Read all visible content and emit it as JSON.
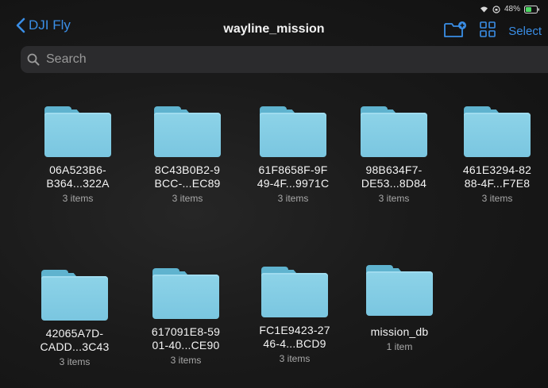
{
  "status_bar": {
    "battery": "48%"
  },
  "nav": {
    "back_label": "DJI Fly",
    "title": "wayline_mission",
    "select_label": "Select"
  },
  "search": {
    "placeholder": "Search"
  },
  "folders": [
    {
      "name_line1": "06A523B6-",
      "name_line2": "B364...322A",
      "count": "3 items"
    },
    {
      "name_line1": "8C43B0B2-9",
      "name_line2": "BCC-...EC89",
      "count": "3 items"
    },
    {
      "name_line1": "61F8658F-9F",
      "name_line2": "49-4F...9971C",
      "count": "3 items"
    },
    {
      "name_line1": "98B634F7-",
      "name_line2": "DE53...8D84",
      "count": "3 items"
    },
    {
      "name_line1": "461E3294-82",
      "name_line2": "88-4F...F7E8",
      "count": "3 items"
    },
    {
      "name_line1": "42065A7D-",
      "name_line2": "CADD...3C43",
      "count": "3 items"
    },
    {
      "name_line1": "617091E8-59",
      "name_line2": "01-40...CE90",
      "count": "3 items"
    },
    {
      "name_line1": "FC1E9423-27",
      "name_line2": "46-4...BCD9",
      "count": "3 items"
    },
    {
      "name_line1": "mission_db",
      "name_line2": "",
      "count": "1 item"
    }
  ],
  "colors": {
    "accent": "#3a8ee6",
    "folder": "#7ac6e0",
    "background": "#151515"
  }
}
